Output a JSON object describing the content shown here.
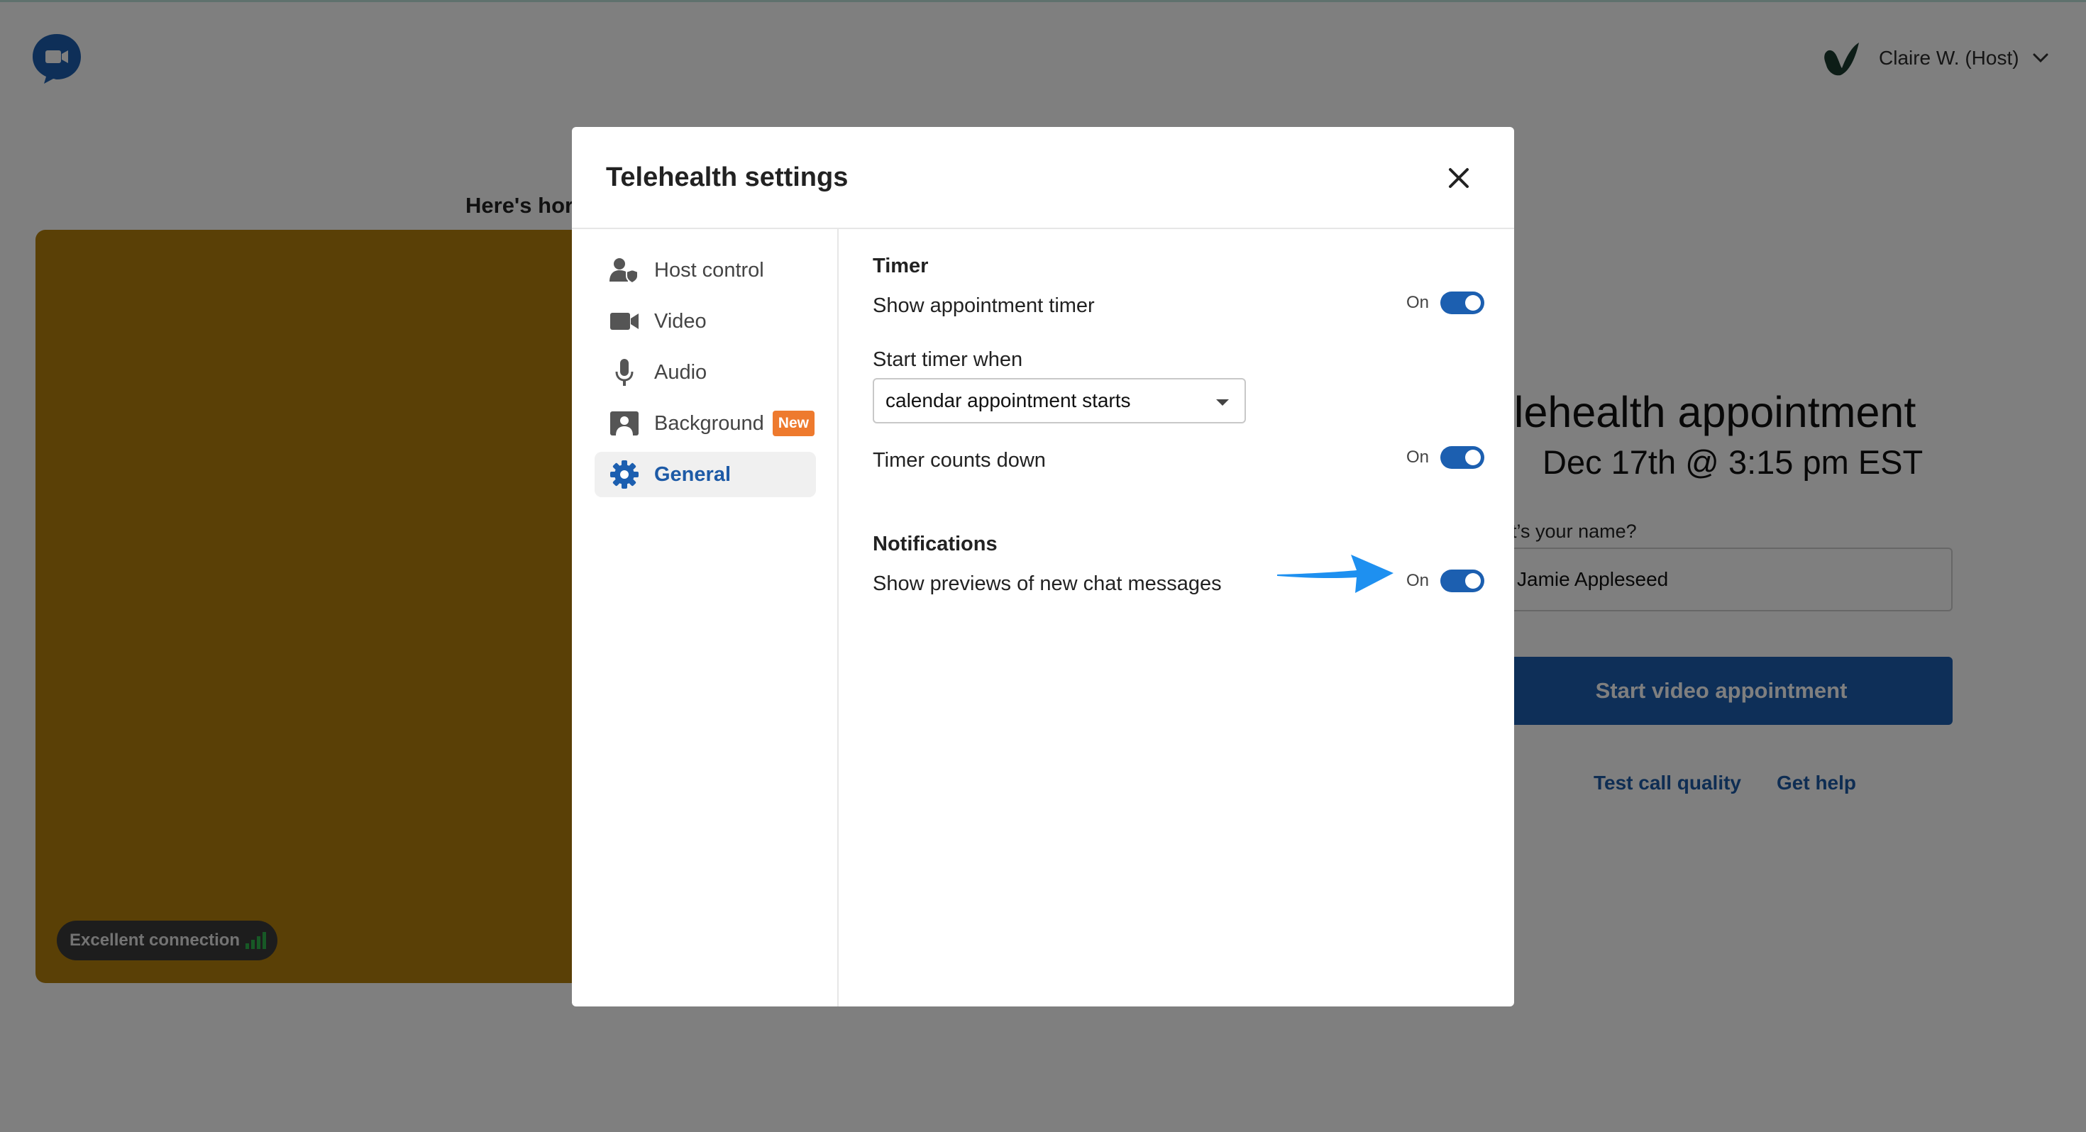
{
  "header": {
    "user_name": "Claire W. (Host)"
  },
  "preview": {
    "heading": "Here's hor",
    "connection_label": "Excellent connection"
  },
  "appointment": {
    "title": "elehealth appointment",
    "date": "Dec 17th @ 3:15 pm EST",
    "name_label": "hat’s your name?",
    "name_value": "Jamie Appleseed",
    "start_button": "Start video appointment",
    "test_link": "Test call quality",
    "help_link": "Get help"
  },
  "modal": {
    "title": "Telehealth settings",
    "nav": [
      {
        "label": "Host control",
        "icon": "host-control-icon"
      },
      {
        "label": "Video",
        "icon": "video-camera-icon"
      },
      {
        "label": "Audio",
        "icon": "microphone-icon"
      },
      {
        "label": "Background",
        "icon": "background-icon",
        "badge": "New"
      },
      {
        "label": "General",
        "icon": "gear-icon",
        "active": true
      }
    ],
    "timer": {
      "title": "Timer",
      "show_timer_label": "Show appointment timer",
      "show_timer_state": "On",
      "start_when_label": "Start timer when",
      "start_when_value": "calendar appointment starts",
      "counts_down_label": "Timer counts down",
      "counts_down_state": "On"
    },
    "notifications": {
      "title": "Notifications",
      "previews_label": "Show previews of new chat messages",
      "previews_state": "On"
    }
  },
  "colors": {
    "accent_blue": "#1c5fb0",
    "link_blue": "#1d5aa6",
    "badge_orange": "#ee7a2e",
    "annotation_arrow": "#1e90f0",
    "video_preview": "#b4800c"
  }
}
